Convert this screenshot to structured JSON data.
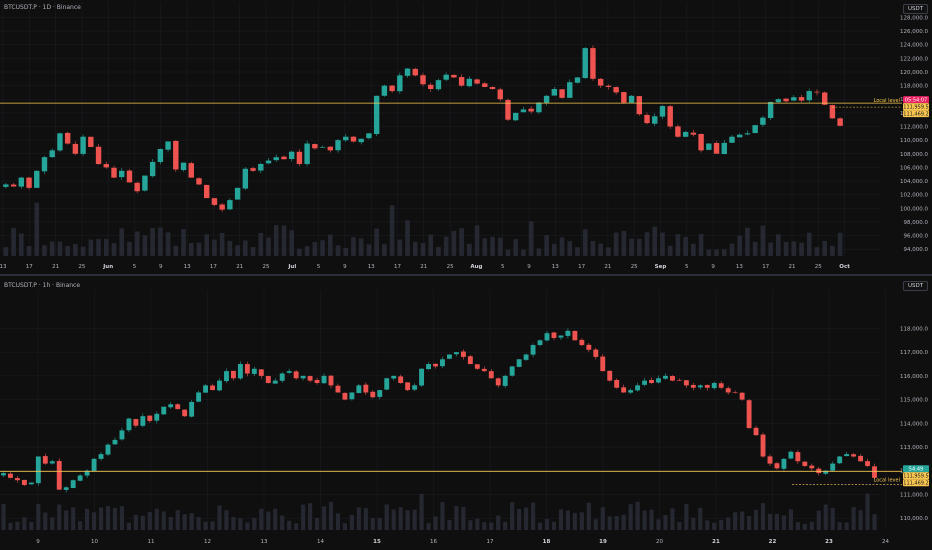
{
  "chart_data": [
    {
      "type": "candlestick",
      "title": "BTCUSDT.P · 1D · Binance",
      "currency": "USDT",
      "price_axis": {
        "ticks": [
          "94,000.0",
          "96,000.0",
          "98,000.0",
          "100,000.0",
          "102,000.0",
          "104,000.0",
          "106,000.0",
          "108,000.0",
          "110,000.0",
          "112,000.0",
          "114,000.0",
          "116,000.0",
          "118,000.0",
          "120,000.0",
          "122,000.0",
          "124,000.0",
          "126,000.0",
          "128,000.0"
        ],
        "ylim": [
          93000,
          128800
        ]
      },
      "time_axis": {
        "ticks": [
          "13",
          "17",
          "21",
          "25",
          "Jun",
          "5",
          "9",
          "13",
          "17",
          "21",
          "25",
          "Jul",
          "5",
          "9",
          "13",
          "17",
          "21",
          "25",
          "Aug",
          "5",
          "9",
          "13",
          "17",
          "21",
          "25",
          "Sep",
          "5",
          "9",
          "13",
          "17",
          "21",
          "25",
          "Oct"
        ],
        "bold_ticks": [
          "Jun",
          "Jul",
          "Aug",
          "Sep",
          "Oct"
        ]
      },
      "candles_close_path": [
        103500,
        103200,
        104500,
        103000,
        105500,
        107500,
        108500,
        111000,
        109500,
        108000,
        110500,
        109000,
        106500,
        106000,
        104500,
        105500,
        103800,
        102500,
        104800,
        106800,
        108700,
        109800,
        105700,
        106700,
        104500,
        103500,
        101500,
        100500,
        99800,
        101200,
        103000,
        105800,
        105500,
        106500,
        107000,
        107500,
        107200,
        108300,
        106500,
        109500,
        108800,
        109000,
        108500,
        110000,
        110500,
        109800,
        110200,
        111000,
        116500,
        118000,
        117200,
        119500,
        120500,
        119500,
        118200,
        117500,
        118800,
        119600,
        119200,
        118000,
        119000,
        118300,
        117800,
        117500,
        116000,
        113000,
        114000,
        114500,
        114200,
        115500,
        116500,
        117500,
        116200,
        118500,
        119200,
        123500,
        119000,
        118000,
        117800,
        117000,
        115500,
        116500,
        113800,
        112500,
        113500,
        115000,
        112000,
        110500,
        111200,
        110800,
        108500,
        109500,
        108000,
        109600,
        110500,
        110800,
        111000,
        112200,
        113300,
        115600,
        116000,
        115700,
        116300,
        115800,
        117200,
        117000,
        115200,
        113200,
        112100
      ],
      "levels": [
        {
          "label": "Local level",
          "value": "111,469.2",
          "kind": "solid"
        }
      ],
      "price_badges": [
        {
          "value": "05:54:07",
          "bg": "#e91e63"
        },
        {
          "value": "111,959.5",
          "bg": "#f9c74f"
        },
        {
          "value": "111,469.2",
          "bg": "#f9c74f"
        }
      ]
    },
    {
      "type": "candlestick",
      "title": "BTCUSDT.P · 1h · Binance",
      "currency": "USDT",
      "price_axis": {
        "ticks": [
          "110,000.0",
          "111,000.0",
          "112,000.0",
          "113,000.0",
          "114,000.0",
          "115,000.0",
          "116,000.0",
          "117,000.0",
          "118,000.0"
        ],
        "ylim": [
          109500,
          119200
        ]
      },
      "time_axis": {
        "ticks": [
          "9",
          "10",
          "11",
          "12",
          "13",
          "14",
          "15",
          "16",
          "17",
          "18",
          "19",
          "20",
          "21",
          "22",
          "23",
          "24"
        ],
        "bold_ticks": [
          "15",
          "18",
          "19",
          "21",
          "22",
          "23"
        ]
      },
      "candles_close_path": [
        111900,
        111700,
        111600,
        111400,
        111500,
        112600,
        112300,
        112400,
        111200,
        111300,
        111600,
        111800,
        112000,
        112500,
        112700,
        113100,
        113300,
        113700,
        114200,
        113900,
        114300,
        114100,
        114400,
        114700,
        114800,
        114600,
        114300,
        114900,
        115300,
        115600,
        115400,
        115800,
        116200,
        115900,
        116500,
        116100,
        116300,
        116000,
        115700,
        115800,
        116100,
        116200,
        115900,
        116000,
        115800,
        115700,
        116000,
        115600,
        115300,
        115000,
        115300,
        115600,
        115300,
        115100,
        115400,
        115900,
        116000,
        115700,
        115400,
        115600,
        116300,
        116500,
        116400,
        116700,
        116900,
        117000,
        116800,
        116500,
        116300,
        116200,
        115900,
        115600,
        116000,
        116400,
        116700,
        116900,
        117300,
        117500,
        117800,
        117600,
        117700,
        117900,
        117500,
        117300,
        117100,
        116800,
        116200,
        115800,
        115500,
        115300,
        115400,
        115600,
        115800,
        115700,
        115900,
        116000,
        115800,
        115800,
        115600,
        115500,
        115600,
        115500,
        115700,
        115500,
        115300,
        115300,
        115000,
        113800,
        113500,
        112600,
        112300,
        112100,
        112500,
        112800,
        112400,
        112200,
        112100,
        111900,
        112000,
        112300,
        112600,
        112700,
        112600,
        112400,
        112200,
        111700
      ],
      "levels": [
        {
          "label": "Local level",
          "value": "111,469.2",
          "kind": "solid"
        }
      ],
      "price_badges": [
        {
          "value": "54:49",
          "bg": "#26a69a"
        },
        {
          "value": "111,959.5",
          "bg": "#f9c74f"
        },
        {
          "value": "111,469.2",
          "bg": "#f9c74f"
        }
      ]
    }
  ],
  "colors": {
    "bg": "#0f0f0f",
    "grid": "#1c1f26",
    "up": "#26a69a",
    "down": "#ef5350",
    "level": "#f9c74f",
    "axis_text": "#b2b5be",
    "volume": "#2a2e39"
  }
}
